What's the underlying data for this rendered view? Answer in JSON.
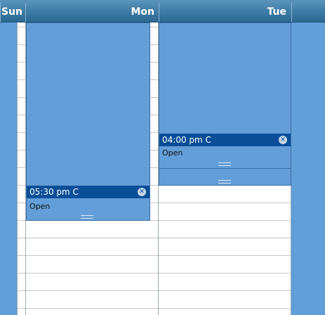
{
  "header": {
    "days": [
      "Sun",
      "Mon",
      "Tue"
    ]
  },
  "events": [
    {
      "time": "05:30 pm C",
      "status": "Open",
      "close_glyph": "✕"
    },
    {
      "time": "04:00 pm C",
      "status": "Open",
      "close_glyph": "✕"
    }
  ],
  "colors": {
    "header": "#3f7ca6",
    "event_fill": "#639ed8",
    "event_bar": "#0b4e98",
    "grid_line": "#c6c6c6"
  }
}
